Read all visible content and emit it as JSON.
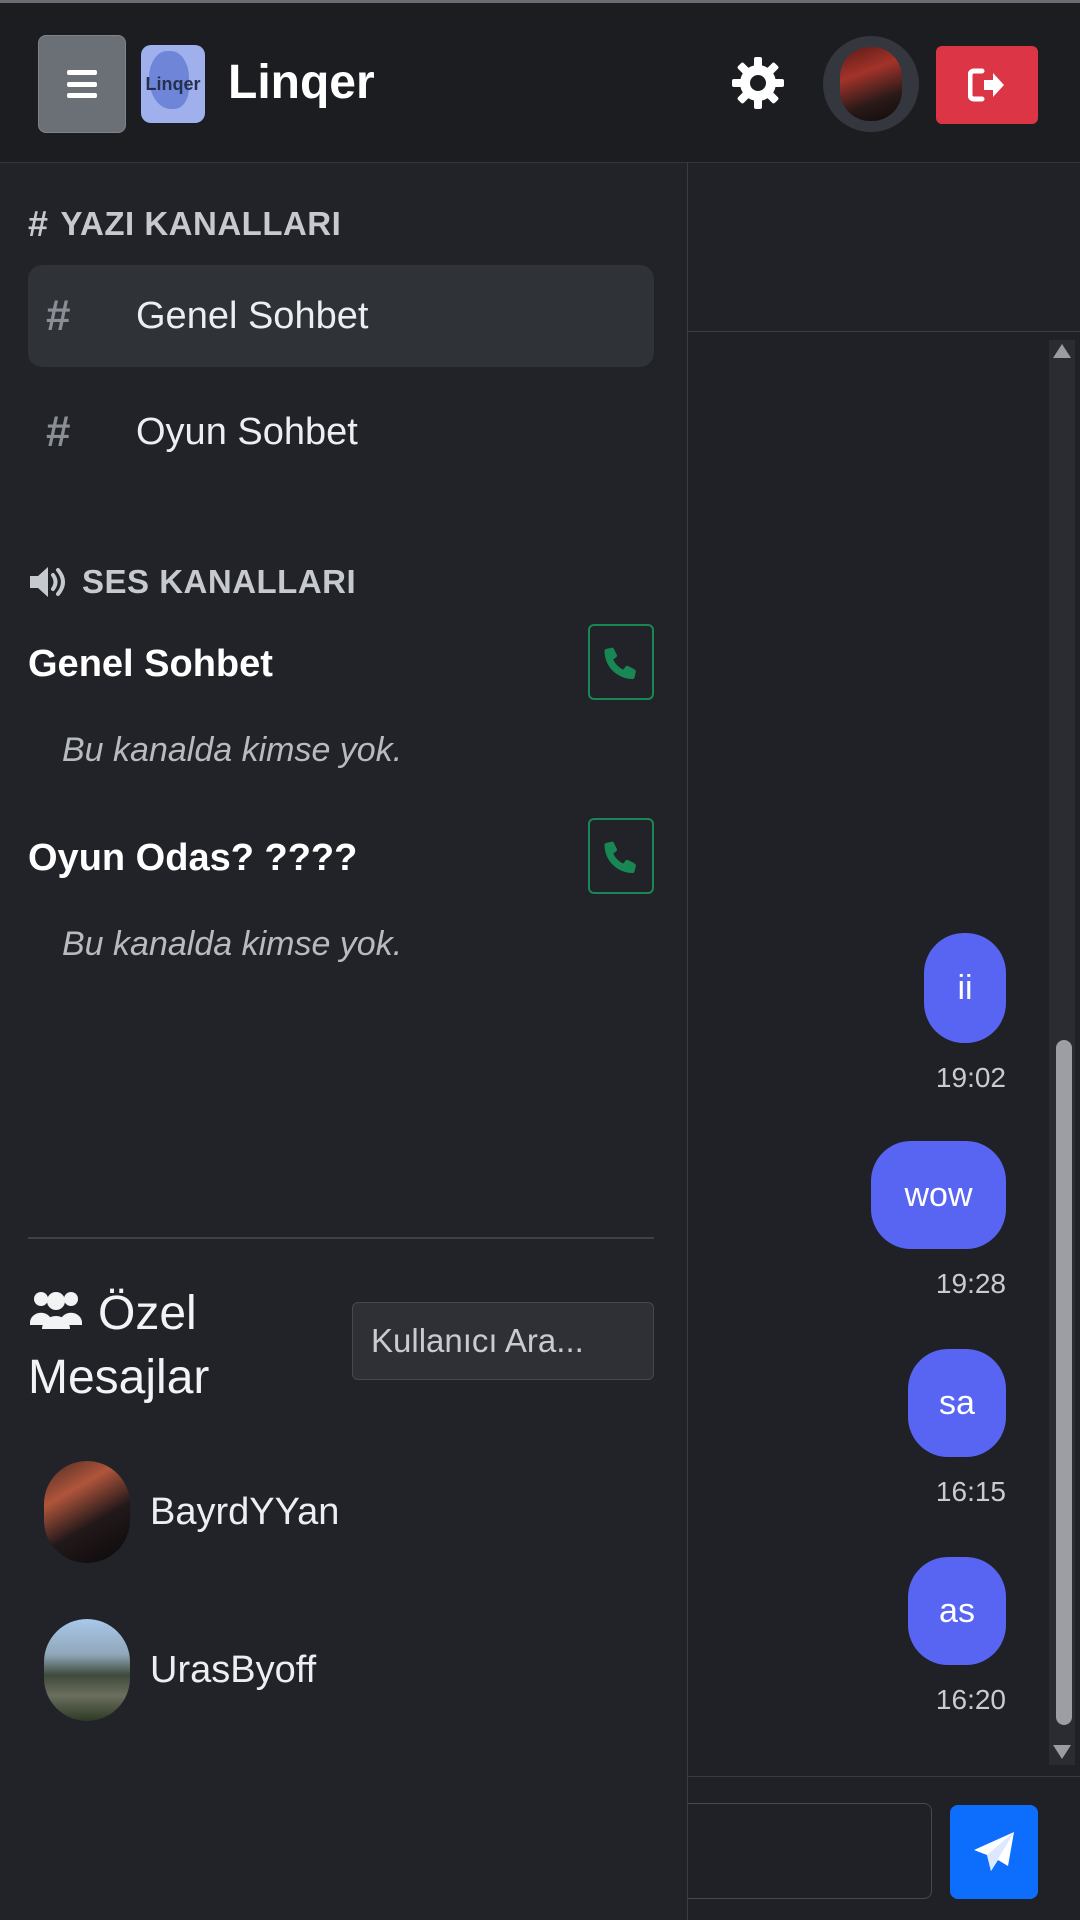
{
  "header": {
    "brand": "Linqer",
    "logo_text": "Linqer",
    "colors": {
      "logout": "#dc3545",
      "menu": "#6b6f76"
    }
  },
  "sidebar": {
    "text_channels_heading": "YAZI KANALLARI",
    "text_channels": [
      {
        "label": "Genel Sohbet",
        "active": true
      },
      {
        "label": "Oyun Sohbet",
        "active": false
      }
    ],
    "voice_channels_heading": "SES KANALLARI",
    "voice_channels": [
      {
        "name": "Genel Sohbet",
        "empty_text": "Bu kanalda kimse yok."
      },
      {
        "name": "Oyun Odas? ????",
        "empty_text": "Bu kanalda kimse yok."
      }
    ],
    "dm_heading_line1": "Özel",
    "dm_heading_line2": "Mesajlar",
    "user_search_placeholder": "Kullanıcı Ara...",
    "dm_users": [
      {
        "name": "BayrdYYan"
      },
      {
        "name": "UrasByoff"
      }
    ]
  },
  "chat": {
    "messages": [
      {
        "text": "ii",
        "time": "19:02"
      },
      {
        "text": "wow",
        "time": "19:28"
      },
      {
        "text": "sa",
        "time": "16:15"
      },
      {
        "text": "as",
        "time": "16:20"
      }
    ],
    "bubble_color": "#5865f2",
    "send_color": "#0d6efd"
  }
}
